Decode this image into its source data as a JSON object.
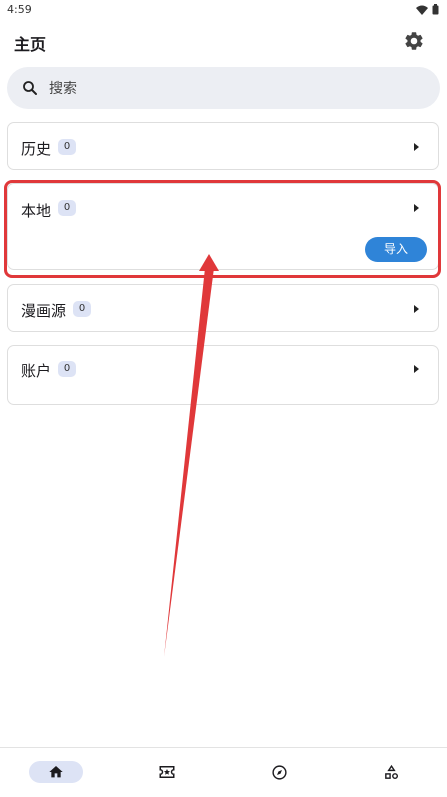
{
  "status_bar": {
    "time": "4:59"
  },
  "app_bar": {
    "title": "主页",
    "settings_icon": "gear-icon"
  },
  "search": {
    "placeholder": "搜索"
  },
  "cards": {
    "history": {
      "title": "历史",
      "count": "0"
    },
    "local": {
      "title": "本地",
      "count": "0",
      "import_label": "导入"
    },
    "sources": {
      "title": "漫画源",
      "count": "0"
    },
    "account": {
      "title": "账户",
      "count": "0"
    }
  },
  "bottom_nav": [
    {
      "icon": "home-icon",
      "active": true
    },
    {
      "icon": "ticket-star-icon",
      "active": false
    },
    {
      "icon": "compass-icon",
      "active": false
    },
    {
      "icon": "categories-shapes-icon",
      "active": false
    }
  ],
  "colors": {
    "accent": "#2f84d8",
    "highlight": "#e0383a",
    "badge": "#dde3f5"
  }
}
